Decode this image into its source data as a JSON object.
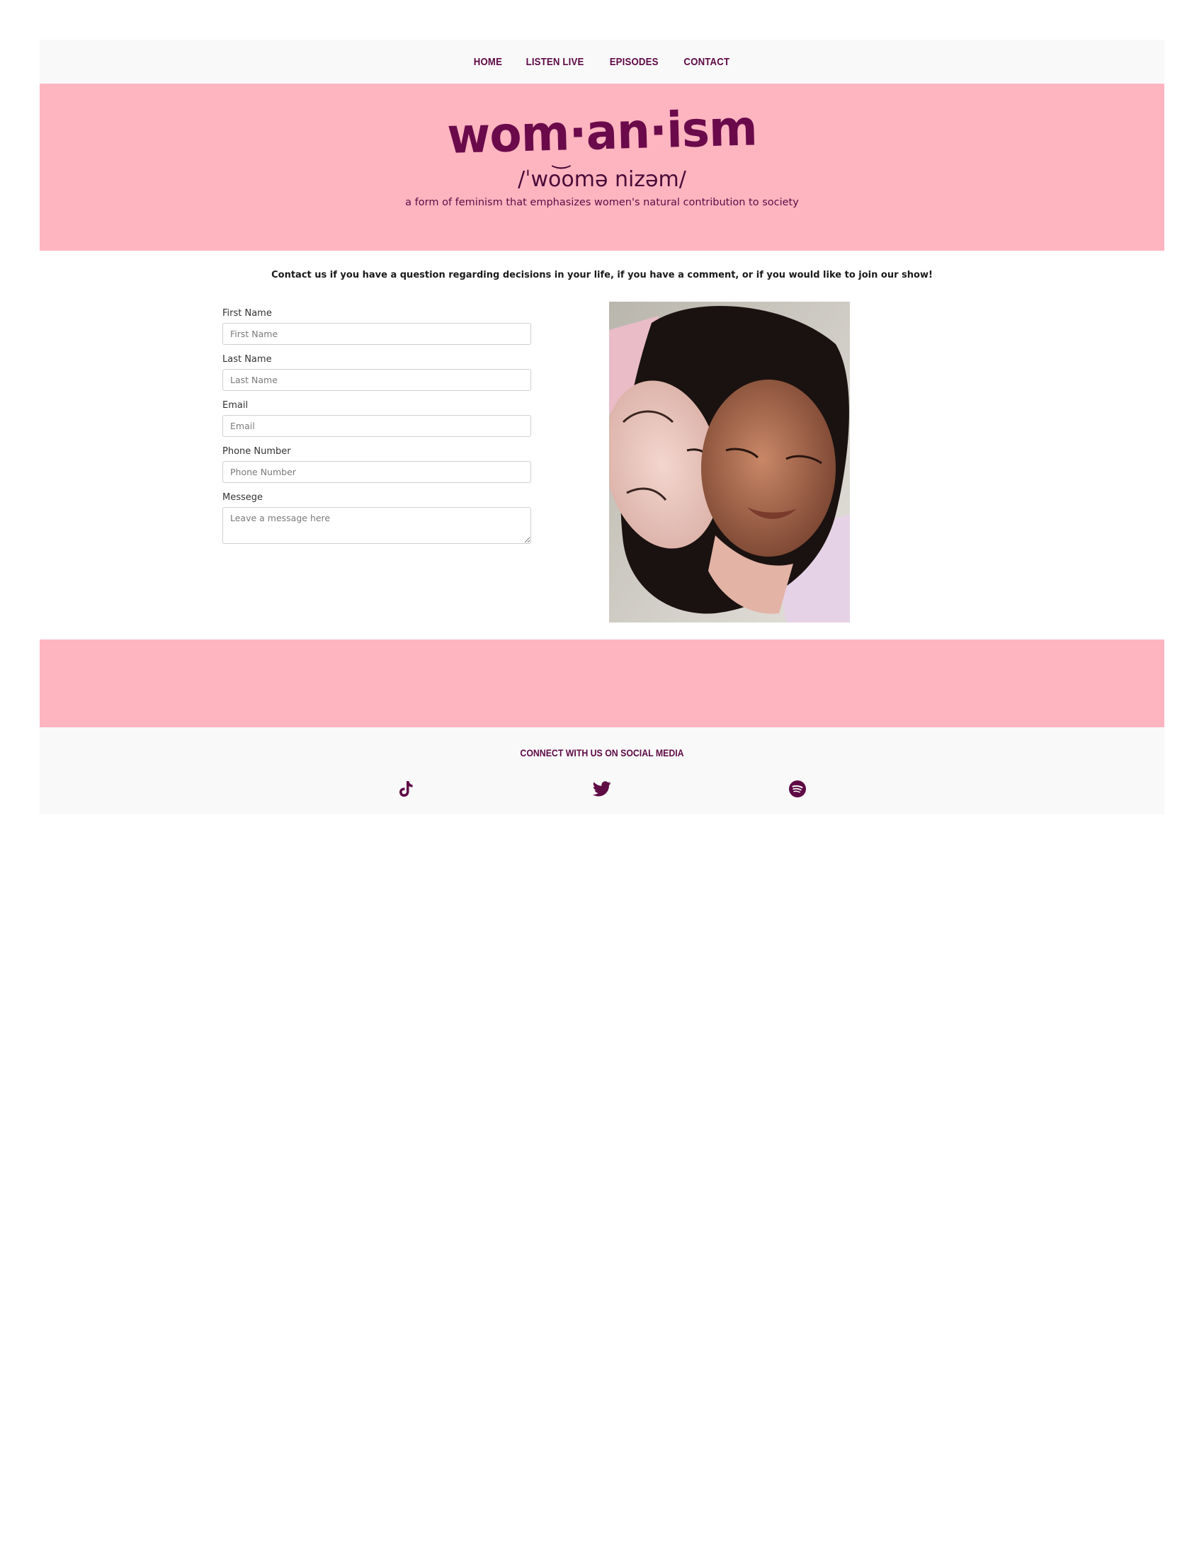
{
  "nav": {
    "items": [
      {
        "label": "HOME"
      },
      {
        "label": "LISTEN LIVE"
      },
      {
        "label": "EPISODES"
      },
      {
        "label": "CONTACT"
      }
    ]
  },
  "hero": {
    "logo": "wom·an·ism",
    "pronunciation": "/ˈwo͝omə nizəm/",
    "tagline": "a form of feminism that emphasizes women's natural contribution to society"
  },
  "intro": "Contact us if you have a question regarding decisions in your life, if you have a comment, or if you would like to join our show!",
  "form": {
    "first_name": {
      "label": "First Name",
      "placeholder": "First Name"
    },
    "last_name": {
      "label": "Last Name",
      "placeholder": "Last Name"
    },
    "email": {
      "label": "Email",
      "placeholder": "Email"
    },
    "phone": {
      "label": "Phone Number",
      "placeholder": "Phone Number"
    },
    "message": {
      "label": "Messege",
      "placeholder": "Leave a message here"
    }
  },
  "footer": {
    "title": "CONNECT WITH US ON SOCIAL MEDIA",
    "icons": [
      "tiktok-icon",
      "twitter-icon",
      "spotify-icon"
    ]
  },
  "colors": {
    "brand": "#5e0a45",
    "pink": "#ffb5c0",
    "light": "#f9f9f9"
  }
}
